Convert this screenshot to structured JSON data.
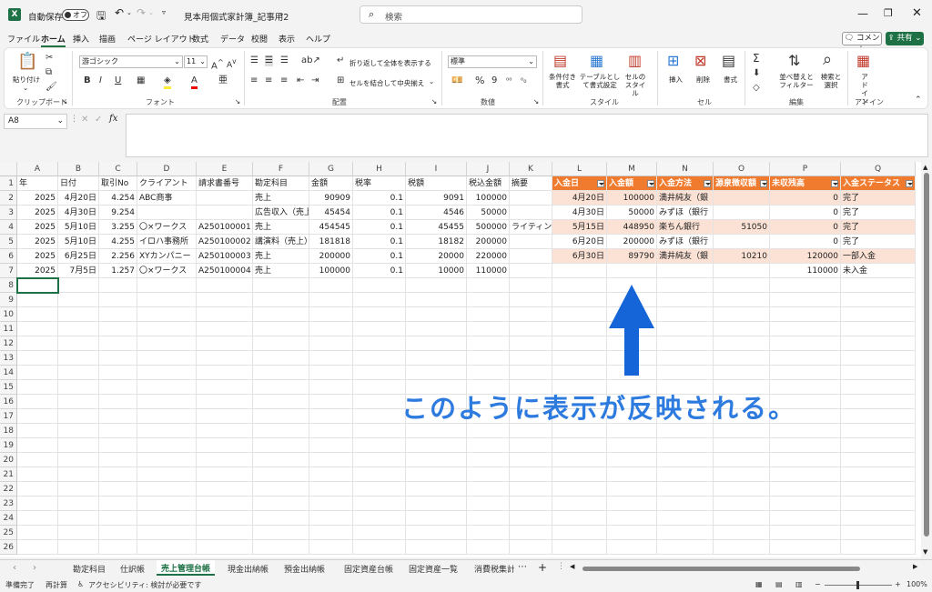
{
  "titlebar": {
    "autosave_label": "自動保存",
    "autosave_state": "オフ",
    "filename": "見本用個式家計簿_記事用2",
    "search_placeholder": "検索"
  },
  "menu": {
    "items": [
      "ファイル",
      "ホーム",
      "挿入",
      "描画",
      "ページ レイアウト",
      "数式",
      "データ",
      "校閲",
      "表示",
      "ヘルプ"
    ],
    "active": "ホーム",
    "comment": "コメント",
    "share": "共有"
  },
  "ribbon": {
    "clipboard": {
      "paste": "貼り付け",
      "label": "クリップボード"
    },
    "font": {
      "name": "游ゴシック",
      "size": "11",
      "label": "フォント"
    },
    "alignment": {
      "wrap": "折り返して全体を表示する",
      "merge": "セルを結合して中央揃え",
      "label": "配置"
    },
    "number": {
      "format": "標準",
      "label": "数値"
    },
    "styles": {
      "cond": "条件付き書式",
      "table": "テーブルとして書式設定",
      "cell": "セルのスタイル",
      "label": "スタイル"
    },
    "cells": {
      "insert": "挿入",
      "delete": "削除",
      "format": "書式",
      "label": "セル"
    },
    "editing": {
      "sort": "並べ替えとフィルター",
      "find": "検索と選択",
      "label": "編集"
    },
    "addin": {
      "btn": "アドイン",
      "label": "アドイン"
    }
  },
  "formula_bar": {
    "name_box": "A8",
    "fx": "fx",
    "value": ""
  },
  "grid": {
    "columns": [
      "A",
      "B",
      "C",
      "D",
      "E",
      "F",
      "G",
      "H",
      "I",
      "J",
      "K",
      "L",
      "M",
      "N",
      "O",
      "P",
      "Q"
    ],
    "rows": [
      "1",
      "2",
      "3",
      "4",
      "5",
      "6",
      "7",
      "8",
      "9",
      "10",
      "11",
      "12",
      "13",
      "14",
      "15",
      "16",
      "17",
      "18",
      "19",
      "20",
      "21",
      "22",
      "23",
      "24",
      "25",
      "26"
    ],
    "headers": [
      "年",
      "日付",
      "取引No",
      "クライアント",
      "請求書番号",
      "勘定科目",
      "金額",
      "税率",
      "税額",
      "税込金額",
      "摘要"
    ],
    "data": [
      [
        "2025",
        "4月20日",
        "4.254",
        "ABC商事",
        "",
        "売上",
        "90909",
        "0.1",
        "9091",
        "100000",
        ""
      ],
      [
        "2025",
        "4月30日",
        "9.254",
        "",
        "",
        "広告収入（売上",
        "45454",
        "0.1",
        "4546",
        "50000",
        ""
      ],
      [
        "2025",
        "5月10日",
        "3.255",
        "〇×ワークス",
        "A250100001",
        "売上",
        "454545",
        "0.1",
        "45455",
        "500000",
        "ライティング"
      ],
      [
        "2025",
        "5月10日",
        "4.255",
        "イロハ事務所",
        "A250100002",
        "講演料（売上）",
        "181818",
        "0.1",
        "18182",
        "200000",
        ""
      ],
      [
        "2025",
        "6月25日",
        "2.256",
        "XYカンパニー",
        "A250100003",
        "売上",
        "200000",
        "0.1",
        "20000",
        "220000",
        ""
      ],
      [
        "2025",
        "7月5日",
        "1.257",
        "〇×ワークス",
        "A250100004",
        "売上",
        "100000",
        "0.1",
        "10000",
        "110000",
        ""
      ]
    ],
    "table_headers": [
      "入金日",
      "入金額",
      "入金方法",
      "源泉徴収額",
      "未収残高",
      "入金ステータス"
    ],
    "table_rows": [
      [
        "4月20日",
        "100000",
        "満井純友（銀",
        "",
        "0",
        "完了"
      ],
      [
        "4月30日",
        "50000",
        "みずほ（銀行",
        "",
        "0",
        "完了"
      ],
      [
        "5月15日",
        "448950",
        "楽ちん銀行",
        "51050",
        "0",
        "完了"
      ],
      [
        "6月20日",
        "200000",
        "みずほ（銀行",
        "",
        "0",
        "完了"
      ],
      [
        "6月30日",
        "89790",
        "満井純友（銀",
        "10210",
        "120000",
        "一部入金"
      ],
      [
        "",
        "",
        "",
        "",
        "110000",
        "未入金"
      ]
    ],
    "selected": "A8"
  },
  "annotation": {
    "caption": "このように表示が反映される。"
  },
  "sheets": {
    "tabs": [
      "勘定科目",
      "仕訳帳",
      "売上管理台帳",
      "現金出納帳",
      "預金出納帳",
      "固定資産台帳",
      "固定資産一覧",
      "消費税集計"
    ],
    "active": "売上管理台帳"
  },
  "status": {
    "ready": "準備完了",
    "recalc": "再計算",
    "accessibility": "アクセシビリティ: 検討が必要です",
    "zoom": "100%"
  },
  "colors": {
    "accent": "#1e7145",
    "table_header": "#f07b2e",
    "table_band": "#fbe2d5",
    "annotation": "#2e7be0"
  }
}
